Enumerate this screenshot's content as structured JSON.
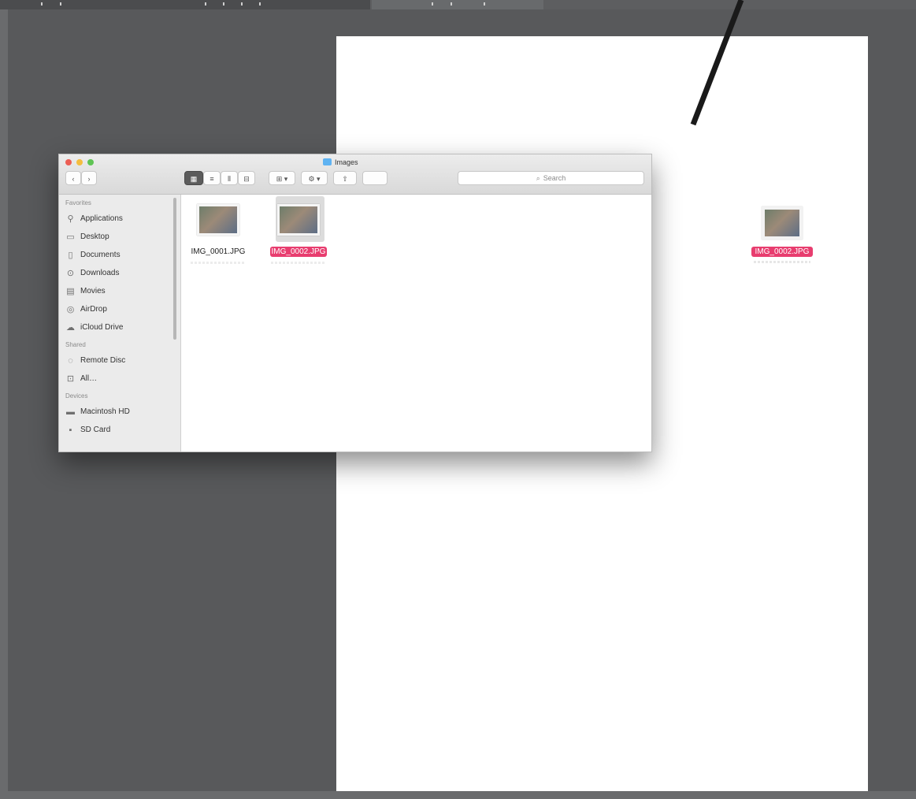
{
  "topbar": {
    "segments": 3
  },
  "finder": {
    "title": "Images",
    "toolbar": {
      "back_label": "‹",
      "forward_label": "›",
      "view_buttons": [
        "▦",
        "≡",
        "⫴",
        "⊟"
      ],
      "group_label": "⊞ ▾",
      "action_label": "⚙ ▾",
      "share_label": "⇧",
      "tag_label": ""
    },
    "search": {
      "placeholder": "Search"
    },
    "sidebar": {
      "favorites_heading": "Favorites",
      "favorites": [
        {
          "label": "Applications",
          "icon": "applications-icon"
        },
        {
          "label": "Desktop",
          "icon": "desktop-icon"
        },
        {
          "label": "Documents",
          "icon": "documents-icon"
        },
        {
          "label": "Downloads",
          "icon": "downloads-icon"
        },
        {
          "label": "Movies",
          "icon": "movies-icon"
        },
        {
          "label": "AirDrop",
          "icon": "airdrop-icon"
        },
        {
          "label": "iCloud Drive",
          "icon": "icloud-icon"
        }
      ],
      "shared_heading": "Shared",
      "shared": [
        {
          "label": "Remote Disc",
          "icon": "remote-disc-icon"
        },
        {
          "label": "All…",
          "icon": "network-icon"
        }
      ],
      "devices_heading": "Devices",
      "devices": [
        {
          "label": "Macintosh HD",
          "icon": "computer-icon"
        },
        {
          "label": "SD Card",
          "icon": "drive-icon"
        }
      ]
    },
    "files": [
      {
        "name": "IMG_0001.JPG",
        "selected": false
      },
      {
        "name": "IMG_0002.JPG",
        "selected": true
      }
    ]
  },
  "placed": {
    "name": "IMG_0002.JPG"
  },
  "colors": {
    "background": "#58595b",
    "artboard": "#ffffff",
    "selection_label": "#e83d6f"
  }
}
